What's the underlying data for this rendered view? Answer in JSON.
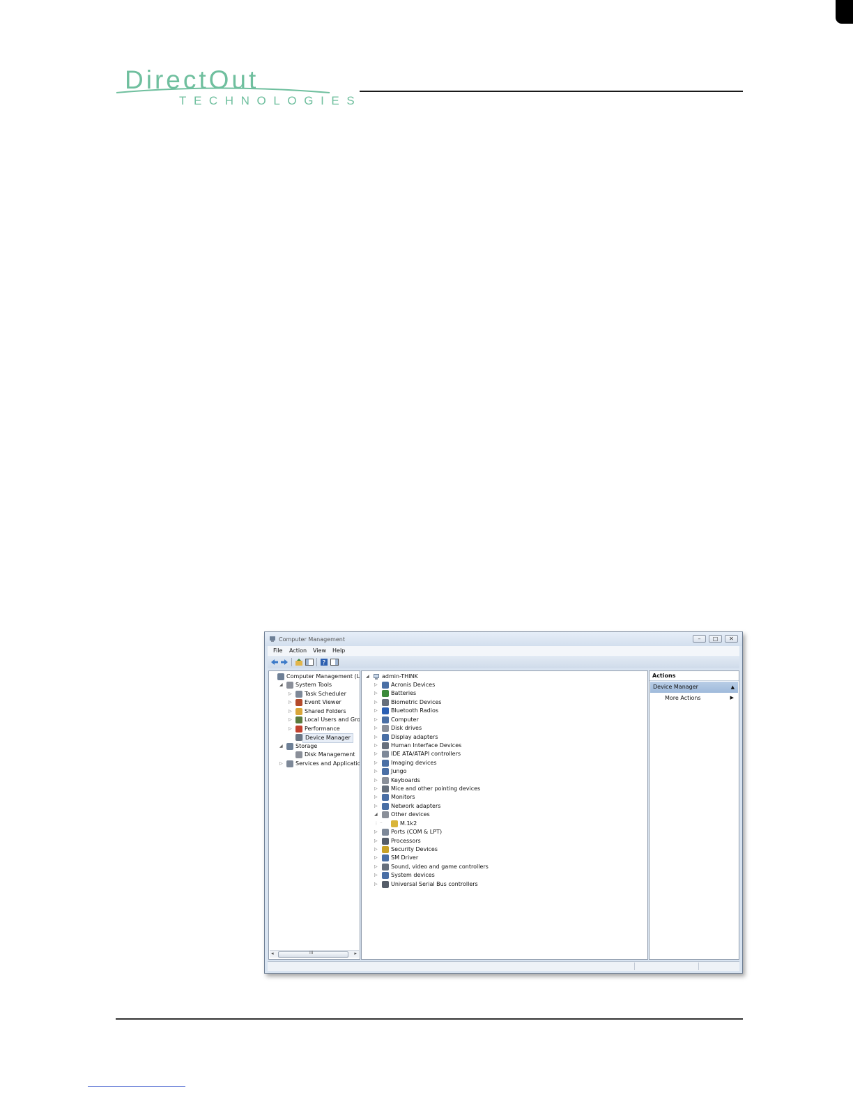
{
  "brand": {
    "name": "DirectOut",
    "subtitle": "TECHNOLOGIES"
  },
  "window": {
    "title": "Computer Management",
    "controls": {
      "minimize": "–",
      "maximize": "□",
      "close": "✕"
    },
    "menu": [
      "File",
      "Action",
      "View",
      "Help"
    ],
    "toolbar_icons": [
      "back-icon",
      "forward-icon",
      "up-folder-icon",
      "show-hide-console-tree-icon",
      "help-icon",
      "show-hide-action-pane-icon"
    ],
    "tree": [
      {
        "label": "Computer Management (Local",
        "indent": 0,
        "expander": "",
        "icon": "computer-management-icon",
        "color": "#6d7f96"
      },
      {
        "label": "System Tools",
        "indent": 1,
        "expander": "◢",
        "icon": "system-tools-icon",
        "color": "#8a8f99"
      },
      {
        "label": "Task Scheduler",
        "indent": 2,
        "expander": "▷",
        "icon": "clock-icon",
        "color": "#7d8898"
      },
      {
        "label": "Event Viewer",
        "indent": 2,
        "expander": "▷",
        "icon": "event-viewer-icon",
        "color": "#b44a2b"
      },
      {
        "label": "Shared Folders",
        "indent": 2,
        "expander": "▷",
        "icon": "shared-folders-icon",
        "color": "#d9a63a"
      },
      {
        "label": "Local Users and Groups",
        "indent": 2,
        "expander": "▷",
        "icon": "users-icon",
        "color": "#5a7a3c"
      },
      {
        "label": "Performance",
        "indent": 2,
        "expander": "▷",
        "icon": "performance-icon",
        "color": "#c2412e"
      },
      {
        "label": "Device Manager",
        "indent": 2,
        "expander": "",
        "icon": "device-manager-icon",
        "color": "#6a7584",
        "selected": true
      },
      {
        "label": "Storage",
        "indent": 1,
        "expander": "◢",
        "icon": "storage-icon",
        "color": "#6d7f96"
      },
      {
        "label": "Disk Management",
        "indent": 2,
        "expander": "",
        "icon": "disk-management-icon",
        "color": "#8a8f99"
      },
      {
        "label": "Services and Applications",
        "indent": 1,
        "expander": "▷",
        "icon": "services-icon",
        "color": "#7d8898"
      }
    ],
    "scrollbar": {
      "left": "◂",
      "right": "▸",
      "grip": "III"
    },
    "device_root": {
      "label": "admin-THINK",
      "expander": "◢",
      "icon": "computer-icon"
    },
    "devices": [
      {
        "label": "Acronis Devices",
        "icon": "acronis-icon",
        "color": "#4a6fa5"
      },
      {
        "label": "Batteries",
        "icon": "battery-icon",
        "color": "#3b8a3b"
      },
      {
        "label": "Biometric Devices",
        "icon": "biometric-icon",
        "color": "#666f7c"
      },
      {
        "label": "Bluetooth Radios",
        "icon": "bluetooth-icon",
        "color": "#2b5fb4"
      },
      {
        "label": "Computer",
        "icon": "monitor-icon",
        "color": "#4a6fa5"
      },
      {
        "label": "Disk drives",
        "icon": "disk-drive-icon",
        "color": "#8a8f99"
      },
      {
        "label": "Display adapters",
        "icon": "display-adapter-icon",
        "color": "#4a6fa5"
      },
      {
        "label": "Human Interface Devices",
        "icon": "hid-icon",
        "color": "#666f7c"
      },
      {
        "label": "IDE ATA/ATAPI controllers",
        "icon": "ide-controller-icon",
        "color": "#7d8898"
      },
      {
        "label": "Imaging devices",
        "icon": "camera-icon",
        "color": "#4a6fa5"
      },
      {
        "label": "Jungo",
        "icon": "jungo-icon",
        "color": "#4a6fa5"
      },
      {
        "label": "Keyboards",
        "icon": "keyboard-icon",
        "color": "#8a8f99"
      },
      {
        "label": "Mice and other pointing devices",
        "icon": "mouse-icon",
        "color": "#666f7c"
      },
      {
        "label": "Monitors",
        "icon": "monitor-icon",
        "color": "#4a6fa5"
      },
      {
        "label": "Network adapters",
        "icon": "network-icon",
        "color": "#4a6fa5"
      },
      {
        "label": "Other devices",
        "icon": "unknown-device-icon",
        "color": "#8a8f99",
        "expanded": true
      },
      {
        "label": "M.1k2",
        "icon": "warning-device-icon",
        "color": "#d9b53a",
        "child": true
      },
      {
        "label": "Ports (COM & LPT)",
        "icon": "port-icon",
        "color": "#7d8898"
      },
      {
        "label": "Processors",
        "icon": "processor-icon",
        "color": "#555d69"
      },
      {
        "label": "Security Devices",
        "icon": "key-icon",
        "color": "#c9a227"
      },
      {
        "label": "SM Driver",
        "icon": "driver-icon",
        "color": "#4a6fa5"
      },
      {
        "label": "Sound, video and game controllers",
        "icon": "speaker-icon",
        "color": "#666f7c"
      },
      {
        "label": "System devices",
        "icon": "system-device-icon",
        "color": "#4a6fa5"
      },
      {
        "label": "Universal Serial Bus controllers",
        "icon": "usb-icon",
        "color": "#555d69"
      }
    ],
    "actions": {
      "header": "Actions",
      "section": "Device Manager",
      "section_arrow": "▲",
      "more": "More Actions",
      "more_arrow": "▶"
    }
  }
}
